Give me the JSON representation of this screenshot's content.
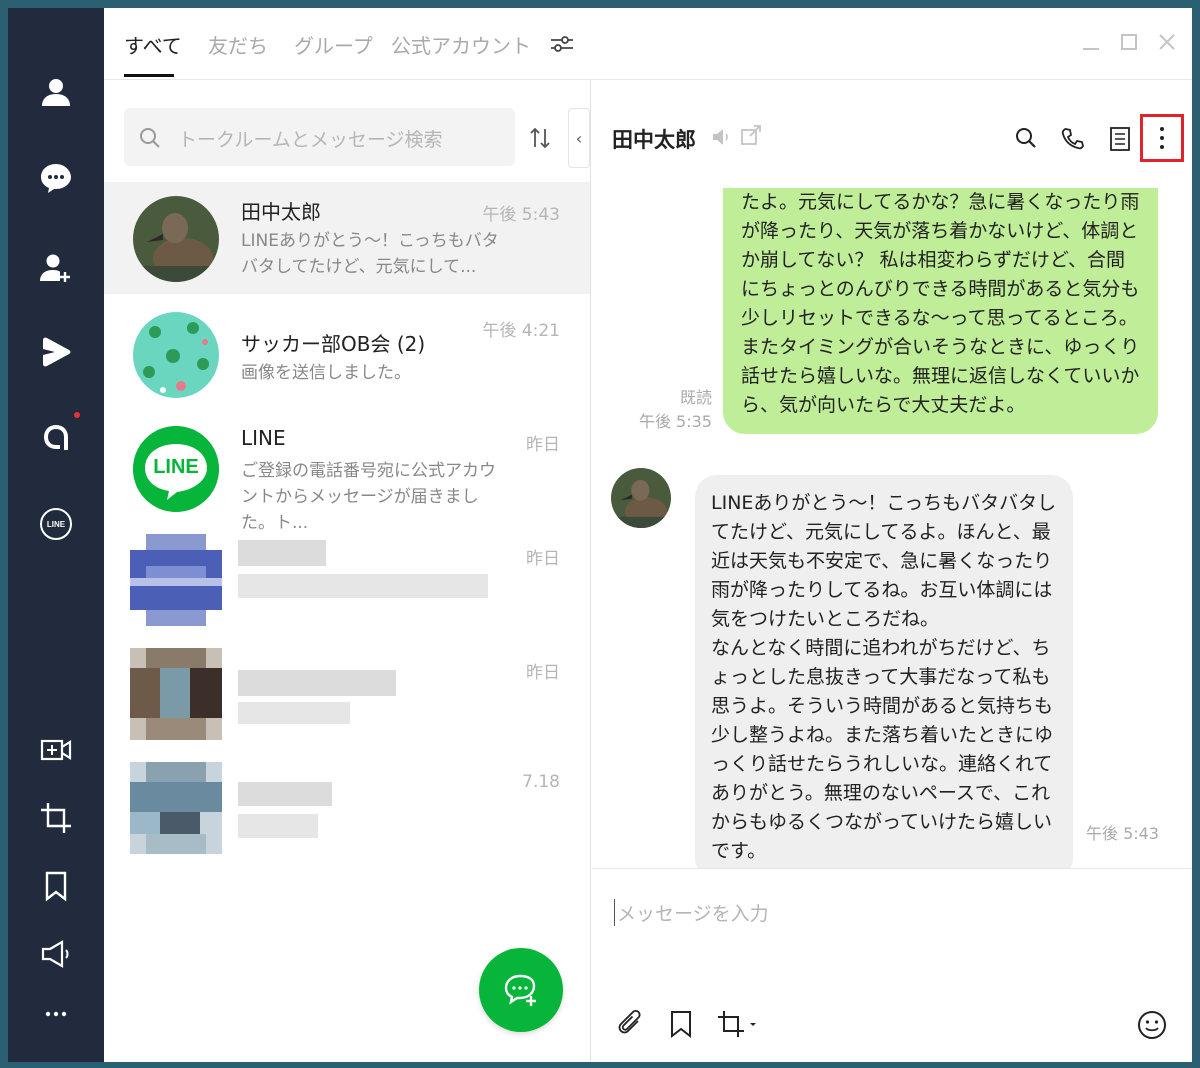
{
  "tabs": [
    {
      "label": "すべて"
    },
    {
      "label": "友だち"
    },
    {
      "label": "グループ"
    },
    {
      "label": "公式アカウント"
    }
  ],
  "search": {
    "placeholder": "トークルームとメッセージ検索"
  },
  "chats": [
    {
      "name": "田中太郎",
      "time": "午後 5:43",
      "preview": "LINEありがとう～！こっちもバタバタしてたけど、元気にして..."
    },
    {
      "name": "サッカー部OB会 (2)",
      "time": "午後 4:21",
      "preview": "画像を送信しました。"
    },
    {
      "name": "LINE",
      "time": "昨日",
      "preview": "ご登録の電話番号宛に公式アカウントからメッセージが届きました。ト...",
      "avatar_text": "LINE"
    },
    {
      "name": "",
      "time": "昨日",
      "preview": ""
    },
    {
      "name": "",
      "time": "昨日",
      "preview": ""
    },
    {
      "name": "",
      "time": "7.18",
      "preview": ""
    }
  ],
  "chat": {
    "title": "田中太郎",
    "sent_message": "たよ。元気にしてるかな？急に暑くなったり雨が降ったり、天気が落ち着かないけど、体調とか崩してない？ 私は相変わらずだけど、合間にちょっとのんびりできる時間があると気分も少しリセットできるな～って思ってるところ。またタイミングが合いそうなときに、ゆっくり話せたら嬉しいな。無理に返信しなくていいから、気が向いたらで大丈夫だよ。",
    "read_label": "既読",
    "sent_time": "午後 5:35",
    "received_message": "LINEありがとう～！こっちもバタバタしてたけど、元気にしてるよ。ほんと、最近は天気も不安定で、急に暑くなったり雨が降ったりしてるね。お互い体調には気をつけたいところだね。\nなんとなく時間に追われがちだけど、ちょっとした息抜きって大事だなって私も思うよ。そういう時間があると気持ちも少し整うよね。また落ち着いたときにゆっくり話せたらうれしいな。連絡くれてありがとう。無理のないペースで、これからもゆるくつながっていけたら嬉しいです。",
    "received_time": "午後 5:43",
    "input_placeholder": "メッセージを入力"
  },
  "colors": {
    "rail": "#212b3d",
    "accent_green": "#07b53b",
    "my_bubble": "#c0ee98",
    "their_bubble": "#efefef",
    "highlight_red": "#e0232c"
  }
}
